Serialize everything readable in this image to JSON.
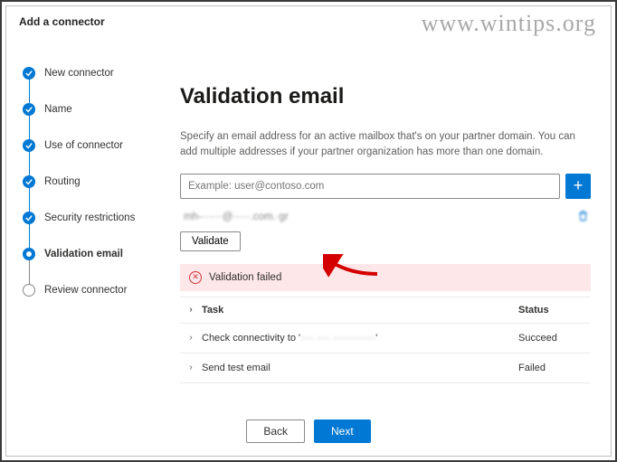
{
  "watermark": "www.wintips.org",
  "header": {
    "title": "Add a connector"
  },
  "steps": [
    {
      "label": "New connector",
      "state": "done"
    },
    {
      "label": "Name",
      "state": "done"
    },
    {
      "label": "Use of connector",
      "state": "done"
    },
    {
      "label": "Routing",
      "state": "done"
    },
    {
      "label": "Security restrictions",
      "state": "done"
    },
    {
      "label": "Validation email",
      "state": "current"
    },
    {
      "label": "Review connector",
      "state": "future"
    }
  ],
  "main": {
    "title": "Validation email",
    "description": "Specify an email address for an active mailbox that's on your partner domain. You can add multiple addresses if your partner organization has more than one domain.",
    "email_placeholder": "Example: user@contoso.com",
    "entered_email": "mh-······@·····.com.·gr",
    "validate_label": "Validate",
    "error_text": "Validation failed",
    "table": {
      "headers": {
        "task": "Task",
        "status": "Status"
      },
      "rows": [
        {
          "task_prefix": "Check connectivity to '",
          "task_suffix": "'",
          "task_blur": "···· ···· ·············",
          "status": "Succeed"
        },
        {
          "task_prefix": "Send test email",
          "task_suffix": "",
          "task_blur": "",
          "status": "Failed"
        }
      ]
    }
  },
  "footer": {
    "back_label": "Back",
    "next_label": "Next"
  }
}
